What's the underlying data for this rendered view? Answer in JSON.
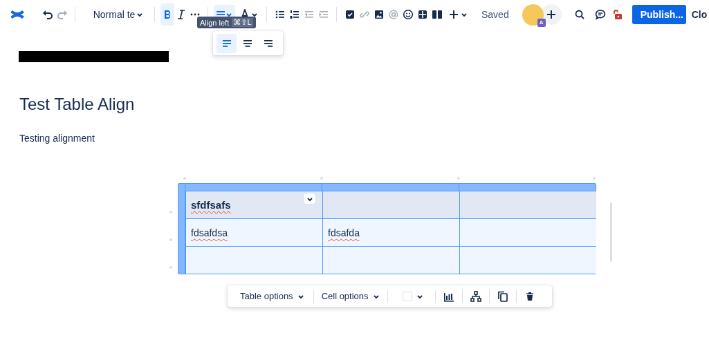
{
  "toolbar": {
    "history": [
      {
        "disabled": false
      },
      {
        "disabled": true
      }
    ],
    "text_style": "Normal te",
    "formatting": [
      {
        "selected": true
      },
      {
        "selected": false
      },
      {
        "selected": false
      }
    ],
    "alignment": {
      "selected": true
    },
    "lists": [
      {
        "disabled": false
      },
      {
        "disabled": false
      },
      {
        "disabled": true
      },
      {
        "disabled": true
      }
    ],
    "insert": [
      {
        "disabled": false
      },
      {
        "disabled": true
      },
      {
        "disabled": false
      },
      {
        "disabled": true
      },
      {
        "disabled": false
      },
      {
        "disabled": false
      },
      {
        "disabled": false
      },
      {
        "disabled": false
      }
    ],
    "status": "Saved",
    "avatar_badge": "A",
    "publish": "Publish...",
    "close": "Clo"
  },
  "tooltip": {
    "label": "Align left",
    "shortcut": "⌘⇧L"
  },
  "align_menu": [
    {
      "selected": true
    },
    {
      "selected": false
    },
    {
      "selected": false
    }
  ],
  "page": {
    "title": "Test Table Align",
    "body": "Testing alignment"
  },
  "table": {
    "rows": [
      {
        "header": true,
        "cells": [
          {
            "text": "sfdfsafs",
            "misspelled": true,
            "selected": true
          },
          null,
          null
        ]
      },
      {
        "header": false,
        "cells": [
          {
            "text": "fdsafdsa",
            "misspelled": true,
            "selected": false
          },
          {
            "text": "fdsafda",
            "misspelled": true,
            "selected": false
          },
          null
        ]
      },
      {
        "header": false,
        "cells": [
          null,
          null,
          null
        ]
      }
    ]
  },
  "table_toolbar": {
    "table_options": "Table options",
    "cell_options": "Cell options"
  }
}
